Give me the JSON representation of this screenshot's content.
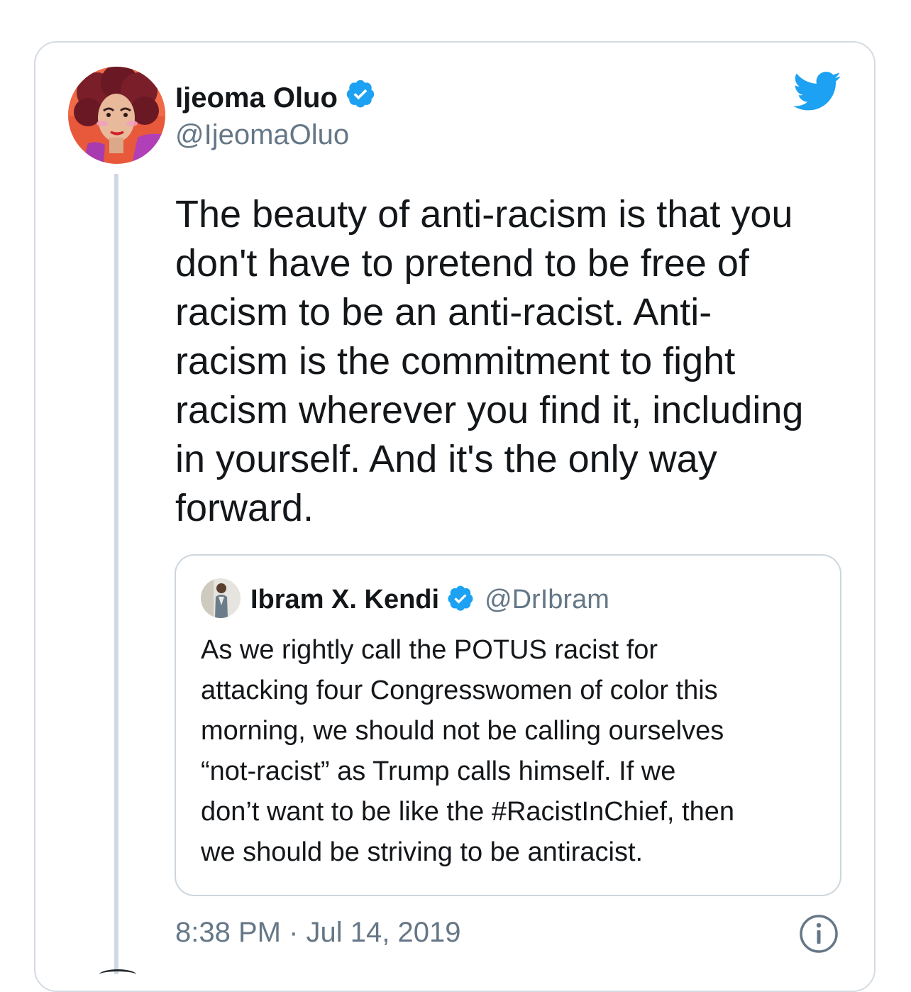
{
  "tweet": {
    "author": {
      "display_name": "Ijeoma Oluo",
      "handle": "@IjeomaOluo",
      "verified": true
    },
    "text_lines": [
      "The beauty of anti-racism is that you",
      "don't have to pretend to be free of",
      "racism to be an anti-racist. Anti-",
      "racism is the commitment to fight",
      "racism wherever you find it, including",
      "in yourself. And it's the only way",
      "forward."
    ],
    "timestamp": "8:38 PM · Jul 14, 2019"
  },
  "quoted_tweet": {
    "author": {
      "display_name": "Ibram X. Kendi",
      "handle": "@DrIbram",
      "verified": true
    },
    "text_lines": [
      "As we rightly call the POTUS racist for",
      "attacking four Congresswomen of color this",
      "morning, we should not be calling ourselves",
      "“not-racist” as Trump calls himself. If we",
      "don’t want to be like the #RacistInChief, then",
      "we should be striving to be antiracist."
    ]
  },
  "icons": {
    "brand": "twitter-bird-icon",
    "verified": "verified-badge-icon",
    "info": "info-icon"
  },
  "colors": {
    "twitter_blue": "#1da1f2",
    "text_primary": "#14171a",
    "text_secondary": "#657786",
    "border": "#ccd6dd"
  }
}
